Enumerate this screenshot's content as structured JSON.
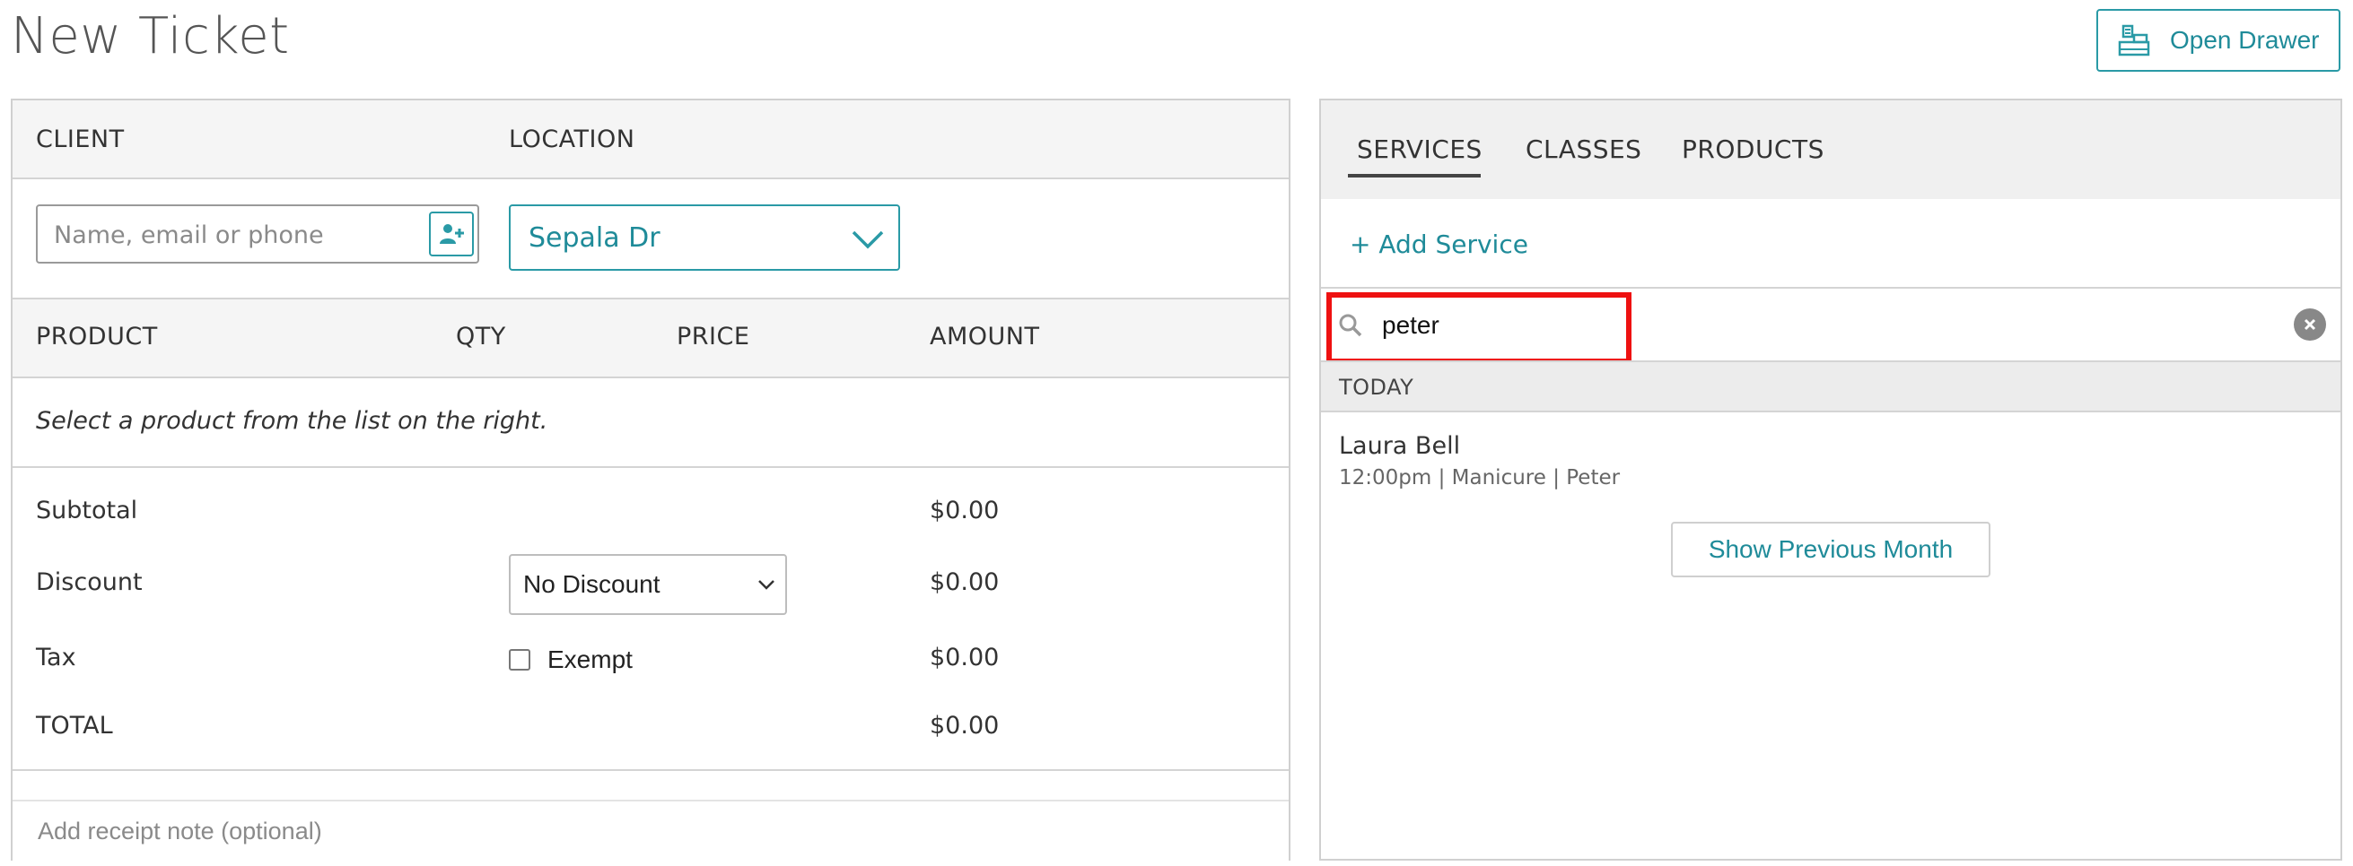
{
  "page": {
    "title": "New Ticket"
  },
  "header": {
    "open_drawer_label": "Open Drawer"
  },
  "ticket": {
    "client_header": "CLIENT",
    "location_header": "LOCATION",
    "client_placeholder": "Name, email or phone",
    "location_value": "Sepala Dr",
    "columns": [
      "PRODUCT",
      "QTY",
      "PRICE",
      "AMOUNT"
    ],
    "empty_hint": "Select a product from the list on the right.",
    "summary": {
      "subtotal_label": "Subtotal",
      "subtotal_value": "$0.00",
      "discount_label": "Discount",
      "discount_option": "No Discount",
      "discount_value": "$0.00",
      "tax_label": "Tax",
      "tax_exempt_label": "Exempt",
      "tax_value": "$0.00",
      "total_label": "TOTAL",
      "total_value": "$0.00"
    },
    "receipt_placeholder": "Add receipt note (optional)"
  },
  "catalog": {
    "tabs": [
      "SERVICES",
      "CLASSES",
      "PRODUCTS"
    ],
    "active_tab": "SERVICES",
    "add_service_label": "+ Add Service",
    "search_value": "peter",
    "section_label": "TODAY",
    "appointments": [
      {
        "client": "Laura Bell",
        "details": "12:00pm | Manicure | Peter"
      }
    ],
    "show_previous_label": "Show Previous Month"
  },
  "colors": {
    "accent": "#1f8b99",
    "highlight": "#ee1111",
    "header_bg": "#f5f5f5"
  }
}
